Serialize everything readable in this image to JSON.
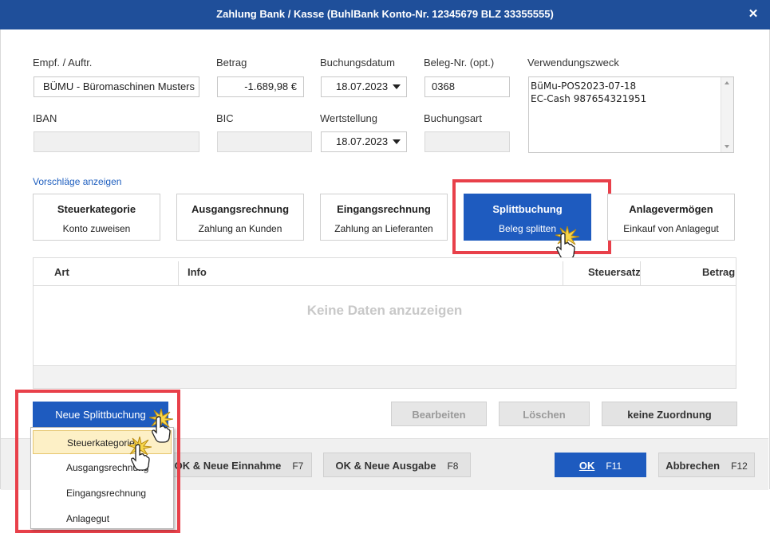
{
  "window": {
    "title": "Zahlung Bank / Kasse (BuhlBank Konto-Nr. 12345679  BLZ 33355555)",
    "close_glyph": "✕"
  },
  "form": {
    "empf_label": "Empf. / Auftr.",
    "empf_value": "BÜMU - Büromaschinen Musters",
    "betrag_label": "Betrag",
    "betrag_value": "-1.689,98 €",
    "buchungsdatum_label": "Buchungsdatum",
    "buchungsdatum_value": "18.07.2023",
    "beleg_label": "Beleg-Nr. (opt.)",
    "beleg_value": "0368",
    "verwendungszweck_label": "Verwendungszweck",
    "verwendungszweck_line1": "BüMu-POS2023-07-18",
    "verwendungszweck_line2": "EC-Cash 987654321951",
    "iban_label": "IBAN",
    "iban_value": "",
    "bic_label": "BIC",
    "bic_value": "",
    "wertstellung_label": "Wertstellung",
    "wertstellung_value": "18.07.2023",
    "buchungsart_label": "Buchungsart",
    "buchungsart_value": ""
  },
  "suggestions": {
    "link": "Vorschläge anzeigen",
    "cards": [
      {
        "title": "Steuerkategorie",
        "subtitle": "Konto zuweisen"
      },
      {
        "title": "Ausgangsrechnung",
        "subtitle": "Zahlung an Kunden"
      },
      {
        "title": "Eingangsrechnung",
        "subtitle": "Zahlung an Lieferanten"
      },
      {
        "title": "Splittbuchung",
        "subtitle": "Beleg splitten"
      },
      {
        "title": "Anlagevermögen",
        "subtitle": "Einkauf von Anlagegut"
      }
    ]
  },
  "table": {
    "columns": [
      "Art",
      "Info",
      "Steuersatz",
      "Betrag"
    ],
    "empty_text": "Keine Daten anzuzeigen"
  },
  "actions": {
    "neue_splittbuchung": "Neue Splittbuchung",
    "bearbeiten": "Bearbeiten",
    "loeschen": "Löschen",
    "keine_zuordnung": "keine Zuordnung"
  },
  "dropdown_menu": {
    "items": [
      "Steuerkategorie",
      "Ausgangsrechnung",
      "Eingangsrechnung",
      "Anlagegut"
    ]
  },
  "footer": {
    "ok_neue_einnahme": "OK & Neue Einnahme",
    "ok_neue_einnahme_key": "F7",
    "ok_neue_ausgabe": "OK & Neue Ausgabe",
    "ok_neue_ausgabe_key": "F8",
    "ok": "OK",
    "ok_key": "F11",
    "abbrechen": "Abbrechen",
    "abbrechen_key": "F12"
  },
  "colors": {
    "titlebar": "#1f4f9a",
    "accent": "#1e5bbf",
    "highlight_frame": "#e8404a",
    "menu_highlight": "#fdf0c6"
  }
}
